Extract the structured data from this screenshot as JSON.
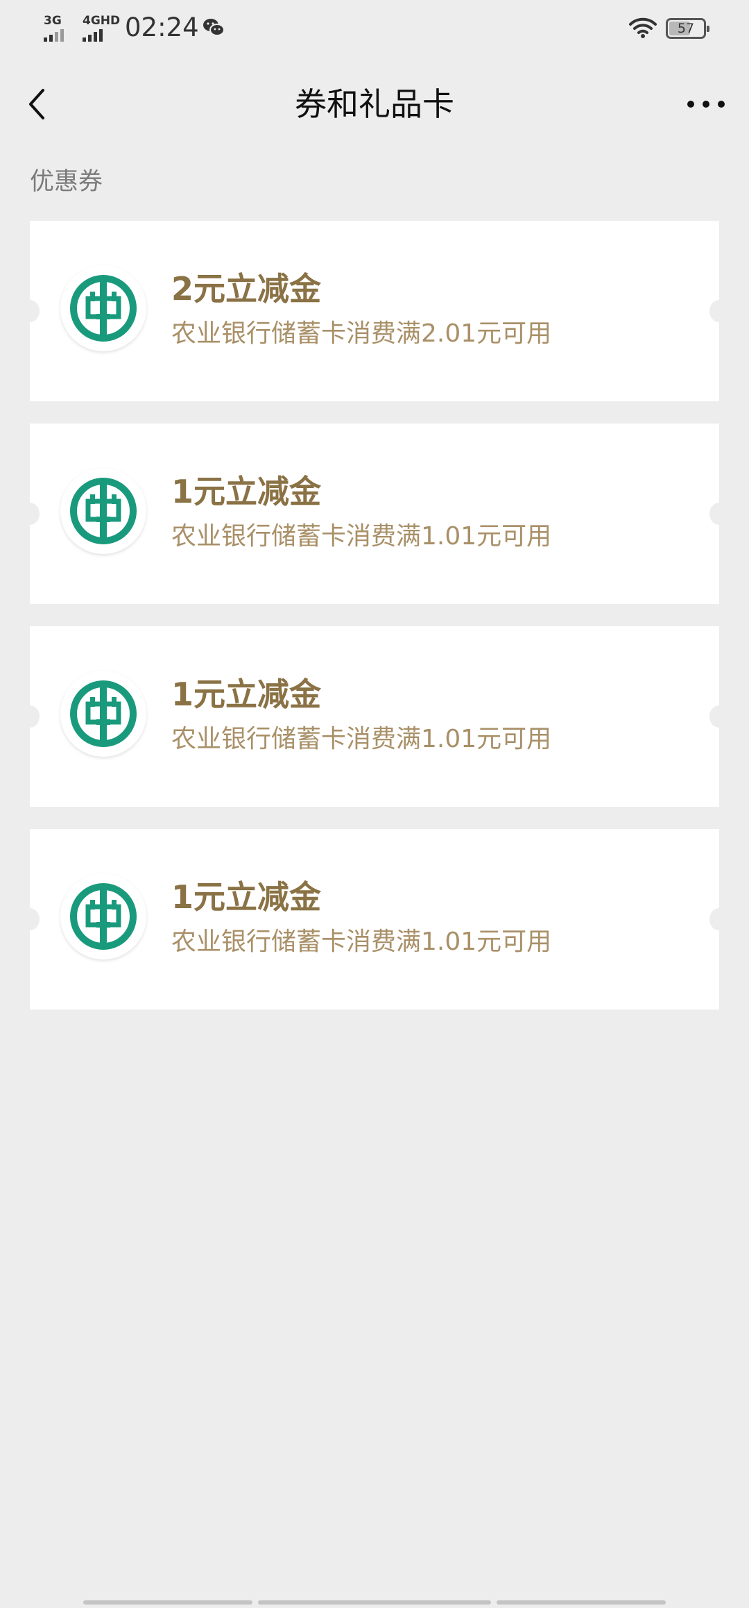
{
  "status_bar": {
    "signal1": "3G",
    "signal2": "4GHD",
    "time": "02:24",
    "battery": "57"
  },
  "nav": {
    "title": "券和礼品卡"
  },
  "section": {
    "title": "优惠券"
  },
  "coupons": [
    {
      "title": "2元立减金",
      "desc": "农业银行储蓄卡消费满2.01元可用"
    },
    {
      "title": "1元立减金",
      "desc": "农业银行储蓄卡消费满1.01元可用"
    },
    {
      "title": "1元立减金",
      "desc": "农业银行储蓄卡消费满1.01元可用"
    },
    {
      "title": "1元立减金",
      "desc": "农业银行储蓄卡消费满1.01元可用"
    }
  ],
  "colors": {
    "background": "#ededed",
    "coupon_title": "#8a7245",
    "coupon_desc": "#a99068",
    "abc_green": "#1a9a7c"
  },
  "icons": {
    "back": "chevron-left-icon",
    "more": "more-dots-icon",
    "bank_logo": "abc-bank-logo-icon"
  }
}
